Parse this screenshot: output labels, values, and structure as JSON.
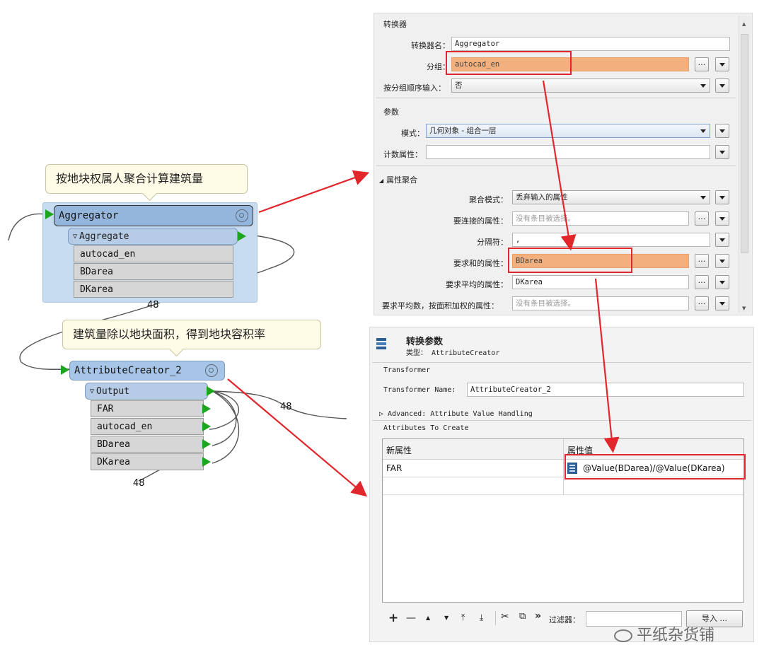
{
  "workspace": {
    "callout1": "按地块权属人聚合计算建筑量",
    "callout2": "建筑量除以地块面积，得到地块容积率",
    "aggregator": {
      "name": "Aggregator",
      "port": "Aggregate",
      "attrs": [
        "autocad_en",
        "BDarea",
        "DKarea"
      ],
      "count_in": "48"
    },
    "attr_creator": {
      "name": "AttributeCreator_2",
      "port": "Output",
      "attrs": [
        "FAR",
        "autocad_en",
        "BDarea",
        "DKarea"
      ],
      "count_out": "48",
      "count_bottom": "48"
    }
  },
  "aggregator_params": {
    "section_transformer": "转换器",
    "name_label": "转换器名：",
    "name_value": "Aggregator",
    "group_label": "分组：",
    "group_value": "autocad_en",
    "group_order_label": "按分组顺序输入：",
    "group_order_value": "否",
    "section_params": "参数",
    "mode_label": "模式：",
    "mode_value": "几何对象 - 组合一层",
    "count_attr_label": "计数属性：",
    "section_attr_agg": "属性聚合",
    "agg_mode_label": "聚合模式：",
    "agg_mode_value": "丢弃输入的属性",
    "concat_label": "要连接的属性：",
    "concat_placeholder": "没有条目被选择。",
    "separator_label": "分隔符：",
    "separator_value": ",",
    "sum_label": "要求和的属性：",
    "sum_value": "BDarea",
    "avg_label": "要求平均的属性：",
    "avg_value": "DKarea",
    "wavg_label": "要求平均数，按面积加权的属性：",
    "wavg_placeholder": "没有条目被选择。",
    "ellipsis": "…"
  },
  "creator_params": {
    "title": "转换参数",
    "type_line": "类型： AttributeCreator",
    "section_transformer": "Transformer",
    "name_label": "Transformer Name:",
    "name_value": "AttributeCreator_2",
    "advanced": "▷ Advanced: Attribute Value Handling",
    "attrs_to_create": "Attributes To Create",
    "col_new": "新属性",
    "col_value": "属性值",
    "rows": [
      {
        "name": "FAR",
        "value": "@Value(BDarea)/@Value(DKarea)"
      }
    ],
    "toolbar": {
      "add": "+",
      "remove": "—",
      "up": "▲",
      "down": "▼",
      "top": "⤒",
      "bottom": "⤓",
      "cut": "✂",
      "copy": "⧉",
      "more": "»",
      "filter_label": "过滤器：",
      "import": "导入 ..."
    }
  },
  "watermark": "平纸杂货铺",
  "colors": {
    "highlight": "#f2b07e",
    "annotation_red": "#e1262c",
    "port_green": "#1ea51e",
    "node_blue": "#a7c5e6"
  }
}
